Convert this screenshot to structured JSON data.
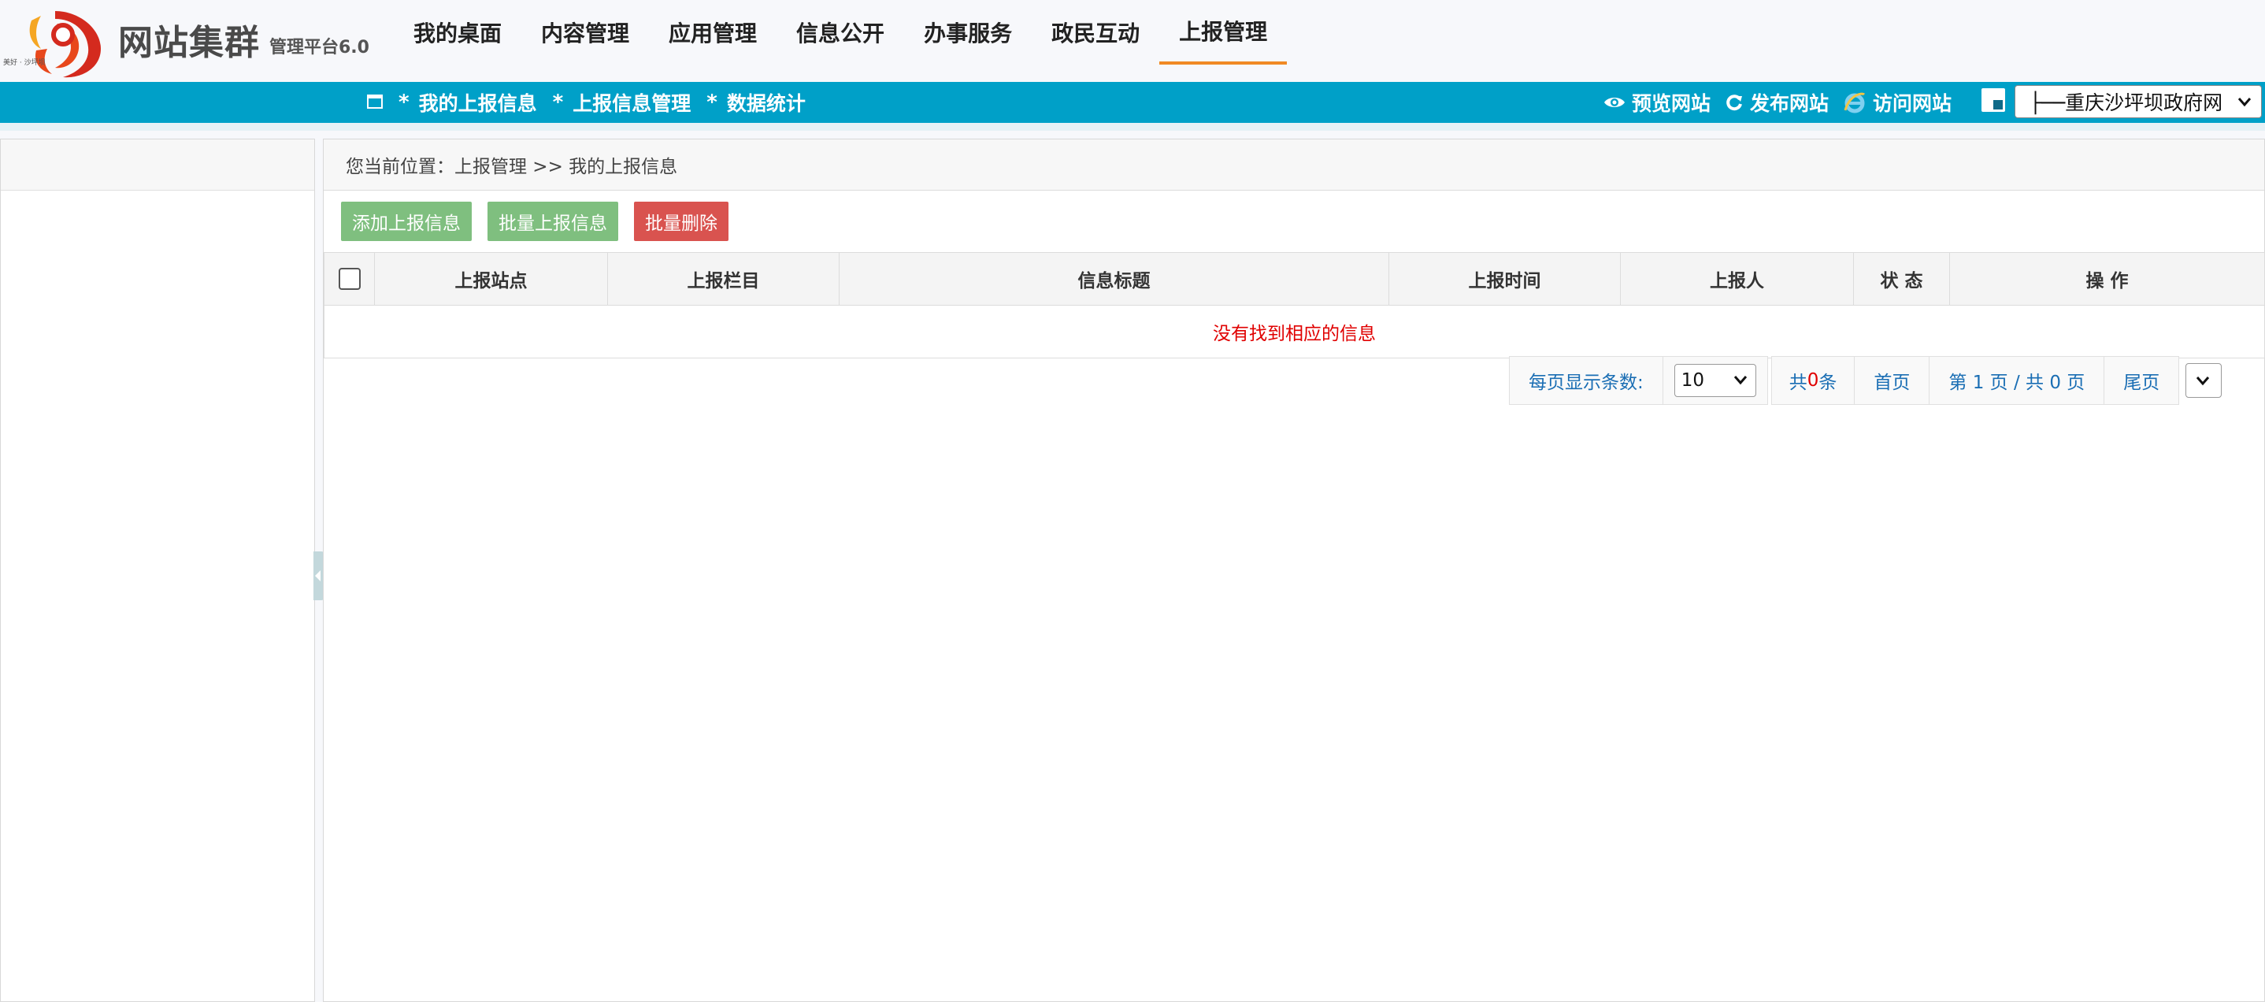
{
  "header": {
    "brand_name": "网站集群",
    "brand_version": "管理平台6.0",
    "seal_text": "美好 · 沙坪坝",
    "nav": [
      {
        "label": "我的桌面"
      },
      {
        "label": "内容管理"
      },
      {
        "label": "应用管理"
      },
      {
        "label": "信息公开"
      },
      {
        "label": "办事服务"
      },
      {
        "label": "政民互动"
      },
      {
        "label": "上报管理",
        "active": true
      }
    ]
  },
  "subbar": {
    "star": "*",
    "items": [
      {
        "label": "我的上报信息"
      },
      {
        "label": "上报信息管理"
      },
      {
        "label": "数据统计"
      }
    ],
    "links": {
      "preview": "预览网站",
      "publish": "发布网站",
      "visit": "访问网站"
    },
    "site_select": "├──重庆沙坪坝政府网"
  },
  "breadcrumb": {
    "text": "您当前位置：上报管理 >> 我的上报信息"
  },
  "toolbar": {
    "add": "添加上报信息",
    "batch_report": "批量上报信息",
    "batch_delete": "批量删除"
  },
  "table": {
    "columns": [
      "上报站点",
      "上报栏目",
      "信息标题",
      "上报时间",
      "上报人",
      "状 态",
      "操 作"
    ],
    "empty_message": "没有找到相应的信息"
  },
  "pager": {
    "page_size_label": "每页显示条数:",
    "page_size": "10",
    "total_prefix": "共",
    "total_count": "0",
    "total_suffix": "条",
    "first": "首页",
    "page_info": "第 1 页 / 共 0 页",
    "last": "尾页"
  },
  "colors": {
    "subbar": "#00a0c8",
    "active_tab_underline": "#f08a24",
    "button_green": "#7fbf7f",
    "button_red": "#d9534f",
    "empty_message": "#e00000",
    "link_blue": "#1a6eb4"
  }
}
